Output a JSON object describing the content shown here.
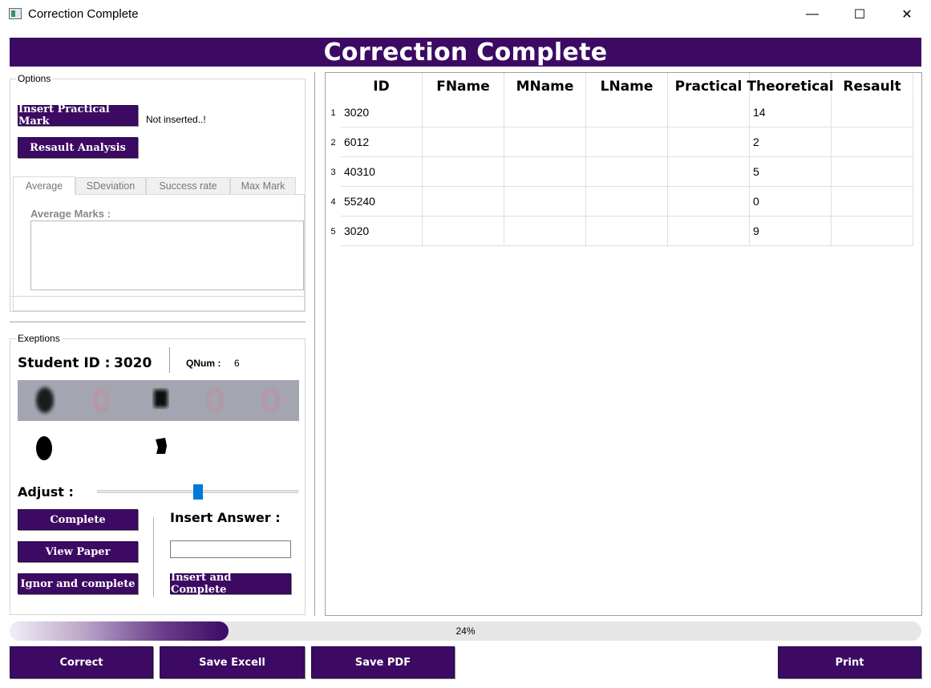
{
  "window": {
    "title": "Correction Complete",
    "controls": {
      "minimize": "—",
      "maximize": "☐",
      "close": "✕"
    }
  },
  "banner": {
    "title": "Correction Complete"
  },
  "options": {
    "group_title": "Options",
    "insert_practical_label": "Insert Practical Mark",
    "insert_status": "Not inserted..!",
    "resault_analysis_label": "Resault Analysis",
    "tabs": [
      {
        "label": "Average",
        "active": true
      },
      {
        "label": "SDeviation",
        "active": false
      },
      {
        "label": "Success rate",
        "active": false
      },
      {
        "label": "Max Mark",
        "active": false
      }
    ],
    "average_label": "Average Marks :"
  },
  "exceptions": {
    "group_title": "Exeptions",
    "student_id_label": "Student ID :",
    "student_id_value": "3020",
    "qnum_label": "QNum :",
    "qnum_value": "6",
    "adjust_label": "Adjust :",
    "adjust_value": 0.5,
    "complete_label": "Complete",
    "view_paper_label": "View Paper",
    "ignore_label": "Ignor and complete",
    "insert_answer_label": "Insert Answer :",
    "insert_answer_value": "",
    "insert_complete_label": "Insert and Complete"
  },
  "table": {
    "columns": [
      "ID",
      "FName",
      "MName",
      "LName",
      "Practical",
      "Theoretical",
      "Resault"
    ],
    "rows": [
      {
        "num": "1",
        "cells": [
          "3020",
          "",
          "",
          "",
          "",
          "14",
          ""
        ]
      },
      {
        "num": "2",
        "cells": [
          "6012",
          "",
          "",
          "",
          "",
          "2",
          ""
        ]
      },
      {
        "num": "3",
        "cells": [
          "40310",
          "",
          "",
          "",
          "",
          "5",
          ""
        ]
      },
      {
        "num": "4",
        "cells": [
          "55240",
          "",
          "",
          "",
          "",
          "0",
          ""
        ]
      },
      {
        "num": "5",
        "cells": [
          "3020",
          "",
          "",
          "",
          "",
          "9",
          ""
        ]
      }
    ]
  },
  "progress": {
    "value": 0.24,
    "text": "24%"
  },
  "footer": {
    "correct_label": "Correct",
    "save_excel_label": "Save Excell",
    "save_pdf_label": "Save PDF",
    "print_label": "Print"
  },
  "colors": {
    "brand_purple": "#3c0a63",
    "slider_blue": "#0078d7"
  }
}
